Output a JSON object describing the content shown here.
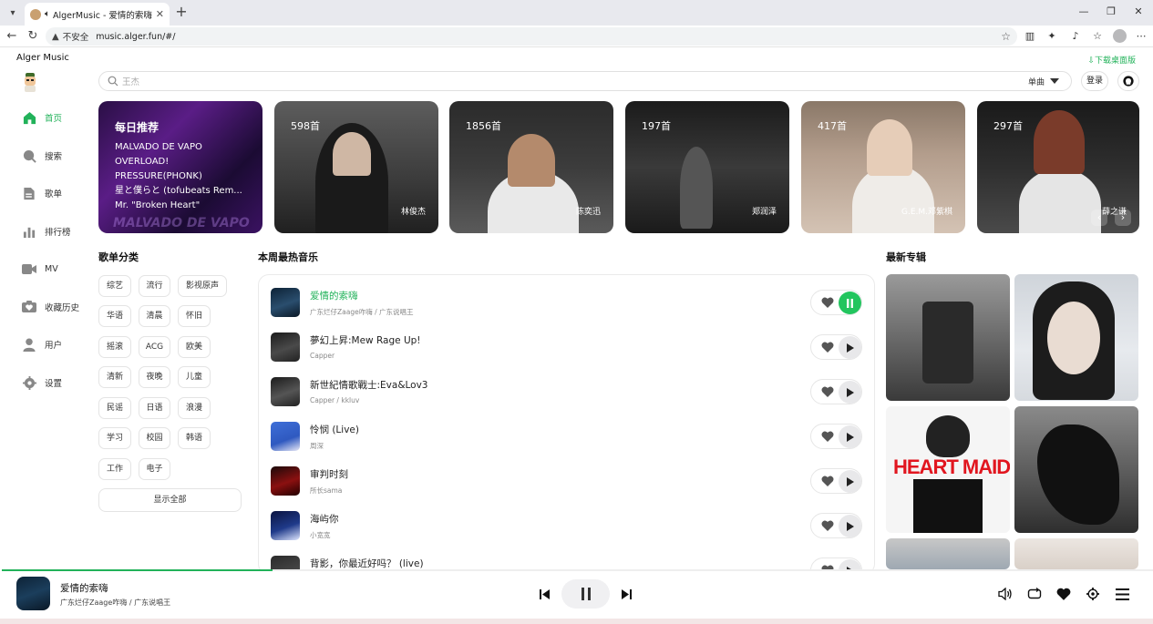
{
  "browser": {
    "tab_title": "AlgerMusic - 爱情的索嗨",
    "address_insecure": "不安全",
    "address_url": "music.alger.fun/#/"
  },
  "app": {
    "name": "Alger Music",
    "download_label": "下载桌面版"
  },
  "sidebar": {
    "items": [
      {
        "label": "首页",
        "icon": "home-icon",
        "active": true
      },
      {
        "label": "搜索",
        "icon": "search-icon",
        "active": false
      },
      {
        "label": "歌单",
        "icon": "playlist-icon",
        "active": false
      },
      {
        "label": "排行榜",
        "icon": "chart-icon",
        "active": false
      },
      {
        "label": "MV",
        "icon": "video-icon",
        "active": false
      },
      {
        "label": "收藏历史",
        "icon": "history-icon",
        "active": false
      },
      {
        "label": "用户",
        "icon": "user-icon",
        "active": false
      },
      {
        "label": "设置",
        "icon": "settings-icon",
        "active": false
      }
    ]
  },
  "search": {
    "placeholder": "王杰",
    "type": "单曲"
  },
  "header": {
    "login": "登录"
  },
  "banner": {
    "daily": {
      "title": "每日推荐",
      "songs": [
        "MALVADO DE VAPO",
        "OVERLOAD!",
        "PRESSURE(PHONK)",
        "星と僕らと (tofubeats Rem...",
        "Mr. \"Broken Heart\""
      ],
      "watermark": "MALVADO DE VAPO"
    },
    "artists": [
      {
        "count": "598首",
        "name": "林俊杰"
      },
      {
        "count": "1856首",
        "name": "陈奕迅"
      },
      {
        "count": "197首",
        "name": "郑润泽"
      },
      {
        "count": "417首",
        "name": "G.E.M.邓紫棋"
      },
      {
        "count": "297首",
        "name": "薛之谦"
      }
    ]
  },
  "categories": {
    "title": "歌单分类",
    "items": [
      "综艺",
      "流行",
      "影视原声",
      "华语",
      "清晨",
      "怀旧",
      "摇滚",
      "ACG",
      "欧美",
      "清新",
      "夜晚",
      "儿童",
      "民谣",
      "日语",
      "浪漫",
      "学习",
      "校园",
      "韩语",
      "工作",
      "电子"
    ],
    "show_all": "显示全部"
  },
  "hot": {
    "title": "本周最热音乐",
    "songs": [
      {
        "name": "爱情的索嗨",
        "artists": "广东烂仔Zaage咋嗨 / 广东说唱王",
        "playing": true
      },
      {
        "name": "夢幻上昇:Mew Rage Up!",
        "artists": "Capper",
        "playing": false
      },
      {
        "name": "新世紀情歌戰士:Eva&Lov3",
        "artists": "Capper / kkluv",
        "playing": false
      },
      {
        "name": "怜悯 (Live)",
        "artists": "周深",
        "playing": false
      },
      {
        "name": "审判时刻",
        "artists": "所长sama",
        "playing": false
      },
      {
        "name": "海屿你",
        "artists": "小宽宽",
        "playing": false
      },
      {
        "name": "背影，你最近好吗？ (live)",
        "artists": "",
        "playing": false
      }
    ]
  },
  "albums": {
    "title": "最新专辑",
    "cover_texts": [
      "HEART MAID"
    ]
  },
  "player": {
    "title": "爱情的索嗨",
    "artist": "广东烂仔Zaage咋嗨 / 广东说唱王",
    "progress": 0.235
  },
  "colors": {
    "accent": "#22b25a"
  }
}
